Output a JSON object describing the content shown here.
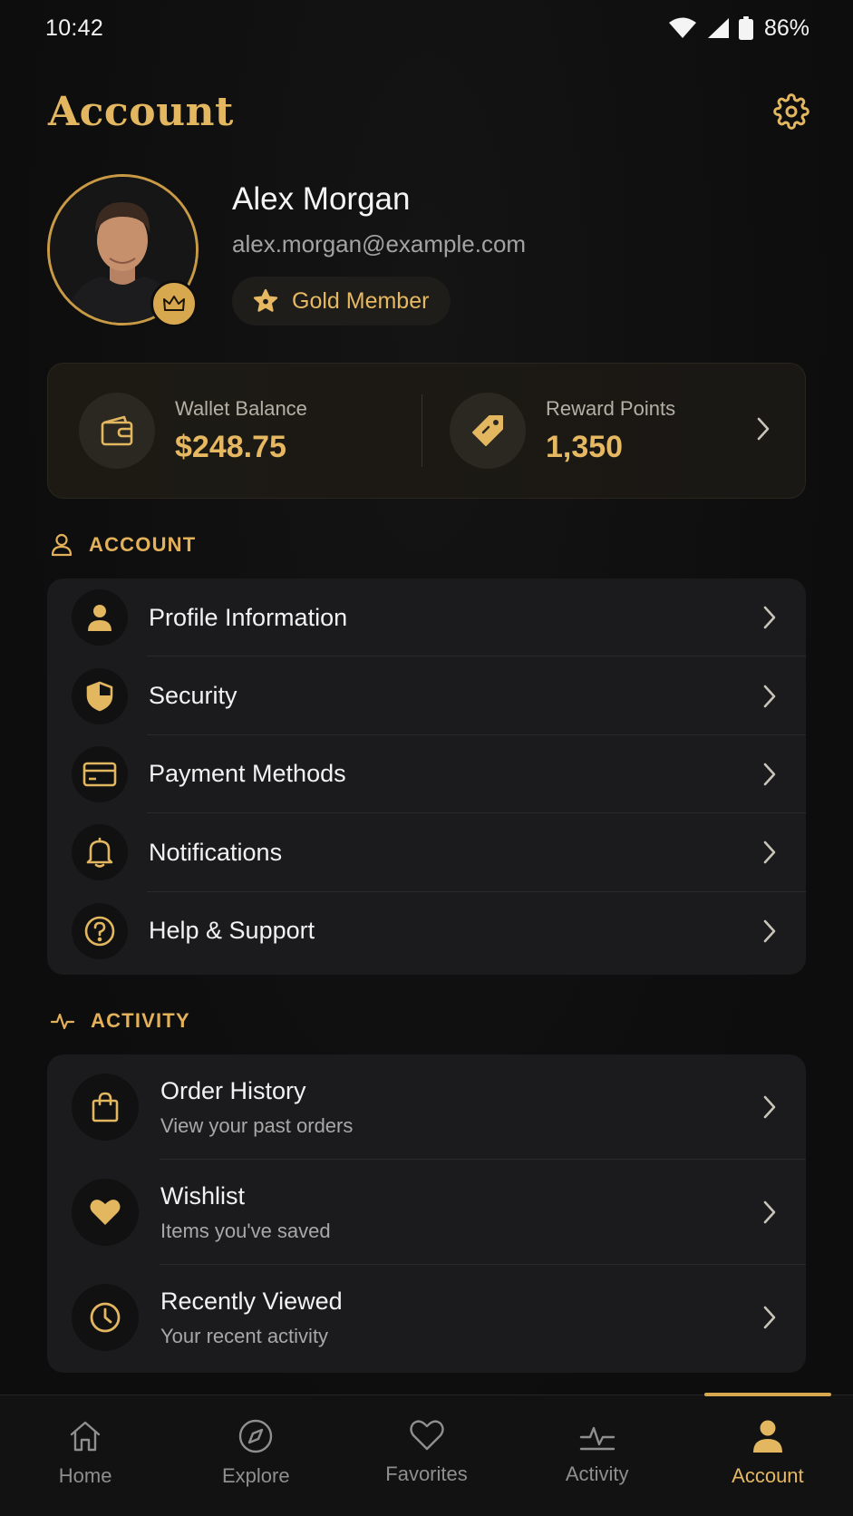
{
  "status_bar": {
    "time": "10:42",
    "battery": "86%",
    "icons": [
      "wifi-icon",
      "signal-icon",
      "battery-icon"
    ]
  },
  "header": {
    "title": "Account",
    "settings_icon": "gear-icon"
  },
  "profile": {
    "name": "Alex Morgan",
    "email": "alex.morgan@example.com",
    "membership": "Gold Member",
    "badge_icon": "crown-icon"
  },
  "wallet": {
    "balance_label": "Wallet Balance",
    "balance_value": "$248.75",
    "points_label": "Reward Points",
    "points_value": "1,350"
  },
  "account_section": {
    "title": "ACCOUNT",
    "items": [
      {
        "label": "Profile Information",
        "icon": "person-icon"
      },
      {
        "label": "Security",
        "icon": "shield-icon"
      },
      {
        "label": "Payment Methods",
        "icon": "credit-card-icon"
      },
      {
        "label": "Notifications",
        "icon": "bell-icon"
      },
      {
        "label": "Help & Support",
        "icon": "help-circle-icon"
      }
    ]
  },
  "activity_section": {
    "title": "ACTIVITY",
    "items": [
      {
        "title": "Order History",
        "subtitle": "View your past orders",
        "icon": "shopping-bag-icon"
      },
      {
        "title": "Wishlist",
        "subtitle": "Items you've saved",
        "icon": "heart-icon"
      },
      {
        "title": "Recently Viewed",
        "subtitle": "Your recent activity",
        "icon": "clock-icon"
      }
    ]
  },
  "bottom_nav": {
    "items": [
      {
        "label": "Home",
        "icon": "home-icon"
      },
      {
        "label": "Explore",
        "icon": "compass-icon"
      },
      {
        "label": "Favorites",
        "icon": "heart-outline-icon"
      },
      {
        "label": "Activity",
        "icon": "pulse-icon"
      },
      {
        "label": "Account",
        "icon": "person-filled-icon"
      }
    ],
    "active": "Account"
  },
  "colors": {
    "accent": "#e2b760",
    "background": "#0e0e0f",
    "card": "#1b1b1d"
  }
}
